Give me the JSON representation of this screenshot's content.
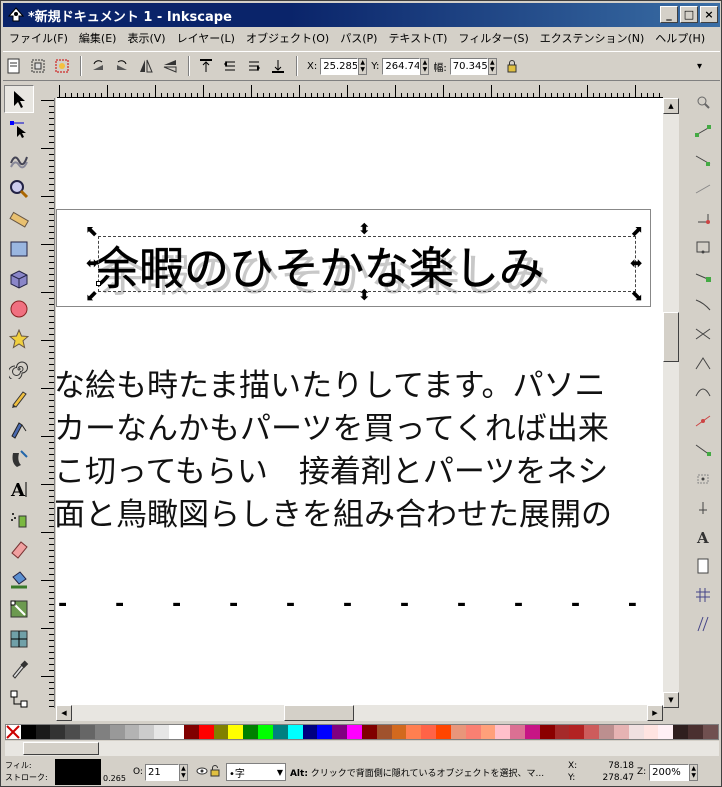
{
  "window": {
    "title": "*新規ドキュメント 1 - Inkscape",
    "min": "_",
    "max": "□",
    "close": "×"
  },
  "menu": [
    "ファイル(F)",
    "編集(E)",
    "表示(V)",
    "レイヤー(L)",
    "オブジェクト(O)",
    "パス(P)",
    "テキスト(T)",
    "フィルター(S)",
    "エクステンション(N)",
    "ヘルプ(H)"
  ],
  "toolbar": {
    "x_label": "X:",
    "x_value": "25.285",
    "y_label": "Y:",
    "y_value": "264.741",
    "w_label": "幅:",
    "w_value": "70.345",
    "lock_icon": "lock-icon",
    "overflow": "▾"
  },
  "canvas": {
    "heading": "余暇のひそかな楽しみ",
    "lines": [
      "な絵も時たま描いたりしてます。パソニ",
      "カーなんかもパーツを買ってくれば出来",
      "こ切ってもらい　接着剤とパーツをネシ",
      "面と鳥瞰図らしきを組み合わせた展開の"
    ],
    "dots": "-   -   -   -   -   -   -   -   -   -   -   -"
  },
  "palette": [
    "#ffffff",
    "#000000",
    "#1a1a1a",
    "#333333",
    "#4d4d4d",
    "#666666",
    "#808080",
    "#999999",
    "#b3b3b3",
    "#cccccc",
    "#e6e6e6",
    "#ffffff",
    "#800000",
    "#ff0000",
    "#808000",
    "#ffff00",
    "#008000",
    "#00ff00",
    "#008080",
    "#00ffff",
    "#000080",
    "#0000ff",
    "#800080",
    "#ff00ff",
    "#800000",
    "#a0522d",
    "#d2691e",
    "#ff7f50",
    "#ff6347",
    "#ff4500",
    "#e9967a",
    "#fa8072",
    "#ffa07a",
    "#ffc0cb",
    "#db7093",
    "#c71585",
    "#8b0000",
    "#a52a2a",
    "#b22222",
    "#cd5c5c",
    "#bc8f8f",
    "#e6b3b3",
    "#f0e0e0",
    "#ffe4e1",
    "#fff0f5",
    "#2f1f1f",
    "#4a3030",
    "#705050"
  ],
  "status": {
    "fill_label": "フィル:",
    "stroke_label": "ストローク:",
    "stroke_width": "0.265",
    "opacity_label": "O:",
    "opacity_value": "21",
    "layer_value": "•字",
    "message_key": "Alt:",
    "message": "クリックで背面側に隠れているオブジェクトを選択、マ...",
    "x_label": "X:",
    "x_value": "78.18",
    "y_label": "Y:",
    "y_value": "278.47",
    "zoom_label": "Z:",
    "zoom_value": "200%"
  }
}
